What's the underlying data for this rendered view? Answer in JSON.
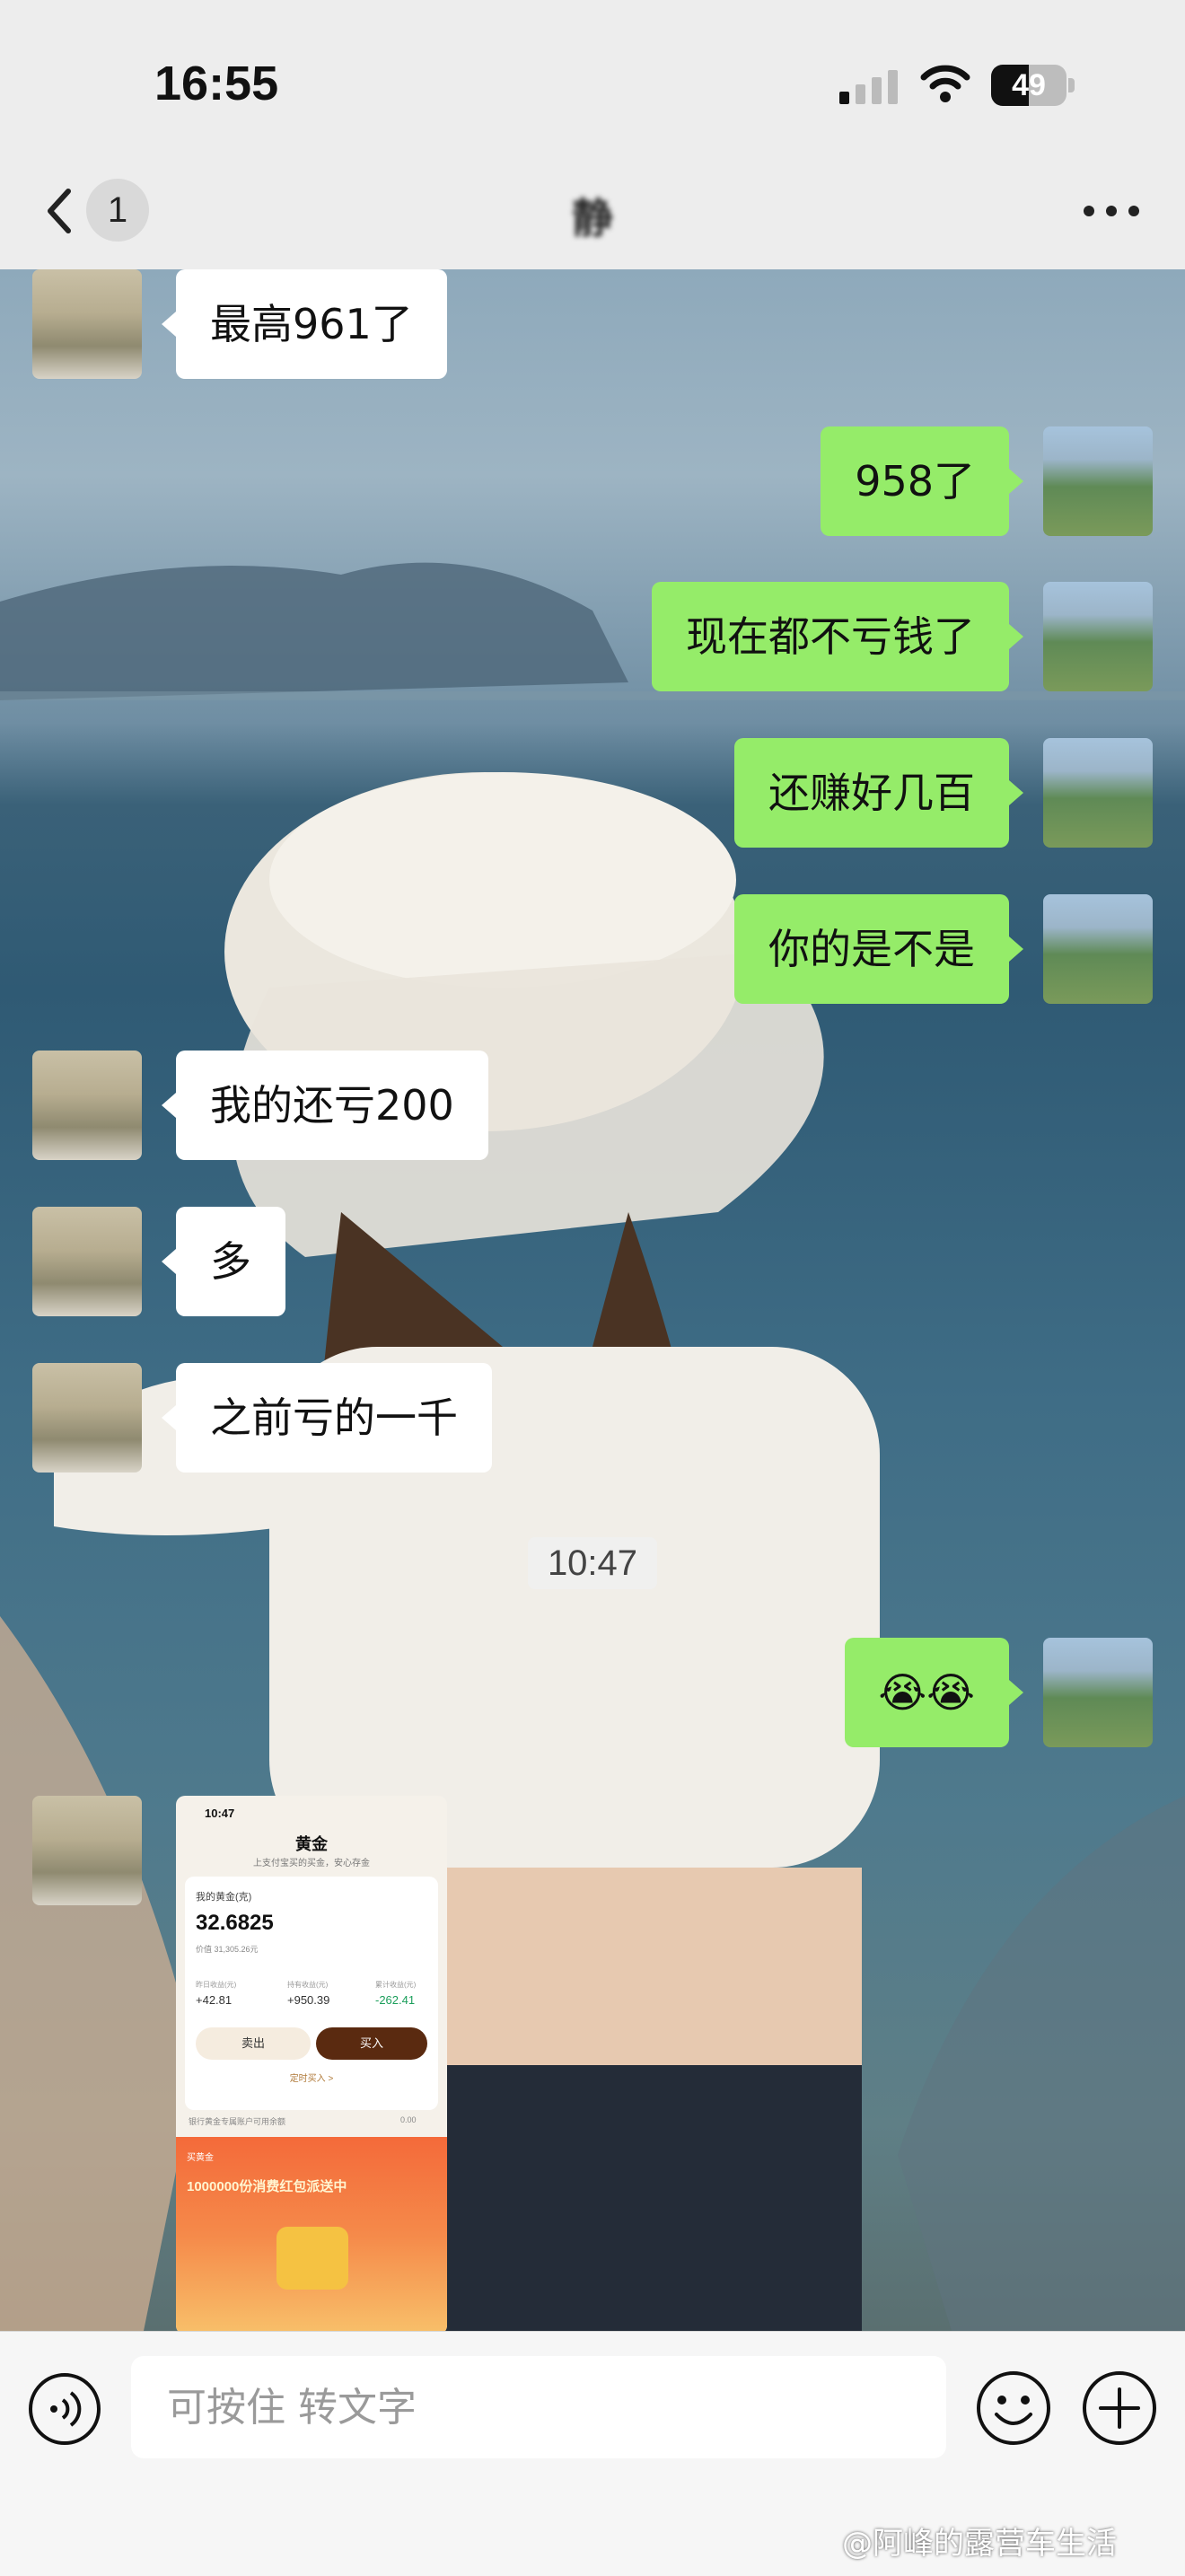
{
  "status_bar": {
    "time": "16:55",
    "battery": "49"
  },
  "header": {
    "back_count": "1",
    "title": "静"
  },
  "messages": [
    {
      "side": "in",
      "text": "最高961了"
    },
    {
      "side": "out",
      "text": "958了"
    },
    {
      "side": "out",
      "text": "现在都不亏钱了"
    },
    {
      "side": "out",
      "text": "还赚好几百"
    },
    {
      "side": "out",
      "text": "你的是不是"
    },
    {
      "side": "in",
      "text": "我的还亏200"
    },
    {
      "side": "in",
      "text": "多"
    },
    {
      "side": "in",
      "text": "之前亏的一千"
    },
    {
      "side": "out",
      "text": "😭😭"
    }
  ],
  "timestamp": "10:47",
  "shared_screenshot": {
    "time": "10:47",
    "title": "黄金",
    "subtitle": "上支付宝买的买金，安心存金",
    "label_my_gold": "我的黄金(克)",
    "amount": "32.6825",
    "value_line": "价值 31,305.26元",
    "stats": [
      {
        "label": "昨日收益(元)",
        "value": "+42.81",
        "color": "#333333"
      },
      {
        "label": "持有收益(元)",
        "value": "+950.39",
        "color": "#333333"
      },
      {
        "label": "累计收益(元)",
        "value": "-262.41",
        "color": "#1a9e5a"
      }
    ],
    "sell_label": "卖出",
    "buy_label": "买入",
    "auto_buy_label": "定时买入 >",
    "bank_row": "银行黄金专属账户可用余额",
    "bank_value": "0.00",
    "promo_brand": "买黄金",
    "promo_text": "1000000份消费红包派送中"
  },
  "input": {
    "placeholder": "可按住 转文字"
  },
  "watermark": "@阿峰的露营车生活"
}
